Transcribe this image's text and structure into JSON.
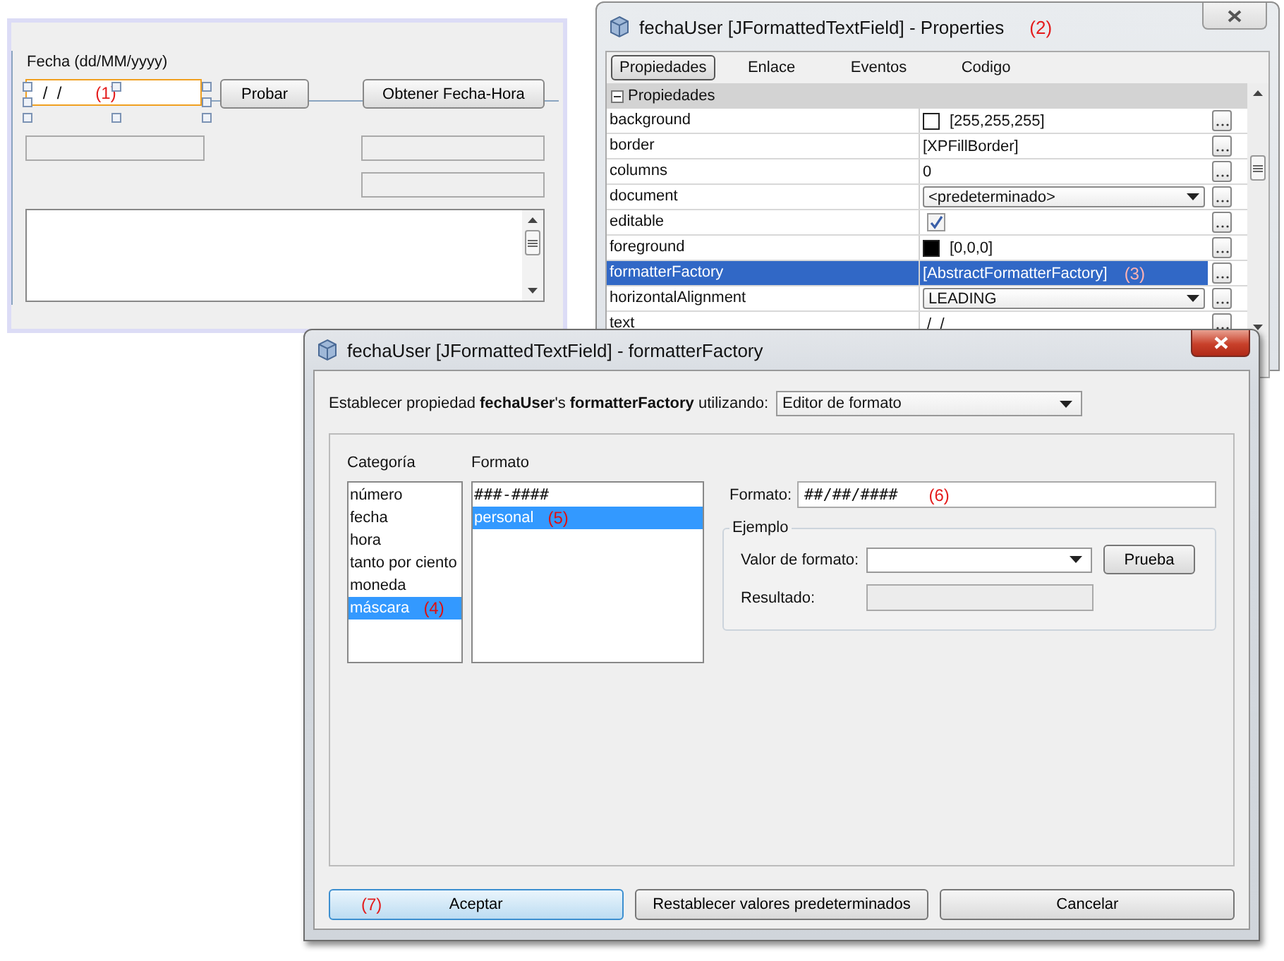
{
  "form": {
    "label": "Fecha (dd/MM/yyyy)",
    "date_field": {
      "value": " /  /",
      "annotation": "(1)",
      "selected": true
    },
    "buttons": [
      "Probar",
      "Obtener Fecha-Hora"
    ]
  },
  "properties_window": {
    "title": "fechaUser [JFormattedTextField] - Properties",
    "annotation": "(2)",
    "tabs": [
      {
        "label": "Propiedades",
        "selected": true
      },
      {
        "label": "Enlace",
        "selected": false
      },
      {
        "label": "Eventos",
        "selected": false
      },
      {
        "label": "Codigo",
        "selected": false
      }
    ],
    "section": {
      "label": "Propiedades",
      "expanded": true
    },
    "rows": [
      {
        "name": "background",
        "kind": "color",
        "value": "[255,255,255]",
        "color": "#ffffff",
        "selected": false
      },
      {
        "name": "border",
        "kind": "text",
        "value": "[XPFillBorder]",
        "selected": false
      },
      {
        "name": "columns",
        "kind": "text",
        "value": "0",
        "selected": false
      },
      {
        "name": "document",
        "kind": "combo",
        "value": "<predeterminado>",
        "selected": false
      },
      {
        "name": "editable",
        "kind": "check",
        "checked": true,
        "selected": false
      },
      {
        "name": "foreground",
        "kind": "color",
        "value": "[0,0,0]",
        "color": "#000000",
        "selected": false
      },
      {
        "name": "formatterFactory",
        "kind": "text",
        "value": "[AbstractFormatterFactory]",
        "annotation": "(3)",
        "selected": true
      },
      {
        "name": "horizontalAlignment",
        "kind": "combo",
        "value": "LEADING",
        "selected": false
      },
      {
        "name": "text",
        "kind": "text",
        "value": " /  /",
        "selected": false
      }
    ]
  },
  "dialog": {
    "title": "fechaUser [JFormattedTextField] - formatterFactory",
    "prompt": "Establecer propiedad **fechaUser**'s **formatterFactory** utilizando:",
    "editor": "Editor de formato",
    "category_heading": "Categoría",
    "categories": [
      {
        "label": "número",
        "selected": false
      },
      {
        "label": "fecha",
        "selected": false
      },
      {
        "label": "hora",
        "selected": false
      },
      {
        "label": "tanto por ciento",
        "selected": false
      },
      {
        "label": "moneda",
        "selected": false
      },
      {
        "label": "máscara",
        "selected": true,
        "annotation": "(4)"
      }
    ],
    "format_heading": "Formato",
    "formats": [
      {
        "label": "###-####",
        "selected": false
      },
      {
        "label": "personal",
        "selected": true,
        "annotation": "(5)"
      }
    ],
    "format_label": "Formato:",
    "format_value": "##/##/####",
    "format_annotation": "(6)",
    "example": {
      "legend": "Ejemplo",
      "value_label": "Valor de formato:",
      "test_button": "Prueba",
      "result_label": "Resultado:"
    },
    "buttons": [
      {
        "label": "Aceptar",
        "default": true,
        "annotation": "(7)"
      },
      {
        "label": "Restablecer valores predeterminados",
        "default": false
      },
      {
        "label": "Cancelar",
        "default": false
      }
    ]
  }
}
